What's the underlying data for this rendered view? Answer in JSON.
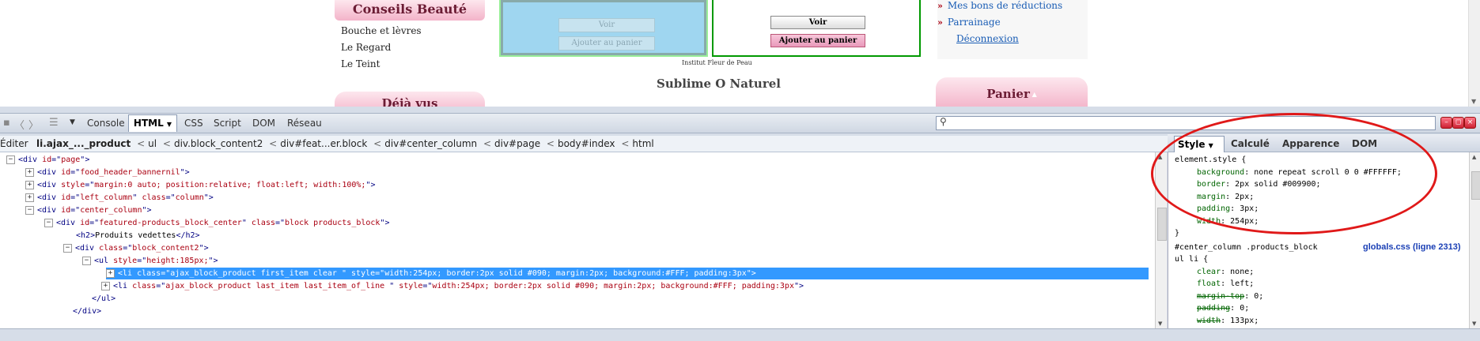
{
  "webpage": {
    "conseils_title": "Conseils Beauté",
    "conseils_items": [
      "Bouche et lèvres",
      "Le Regard",
      "Le Teint"
    ],
    "deja_vus_title": "Déjà vus",
    "product_left": {
      "voir_label": "Voir",
      "cart_label": "Ajouter au panier"
    },
    "product_right": {
      "voir_label": "Voir",
      "cart_label": "Ajouter au panier"
    },
    "institut_label": "Institut Fleur de Peau",
    "sublime_title": "Sublime O Naturel",
    "account_links": [
      "Mes bons de réductions",
      "Parrainage"
    ],
    "logout_link": "Déconnexion",
    "panier_title": "Panier"
  },
  "toolbar": {
    "console_tab": "Console",
    "html_tab": "HTML",
    "css_tab": "CSS",
    "script_tab": "Script",
    "dom_tab": "DOM",
    "reseau_tab": "Réseau",
    "search_placeholder": ""
  },
  "breadcrumb": {
    "edit_label": "Éditer",
    "current": "li.ajax_..._product",
    "items": [
      "ul",
      "div.block_content2",
      "div#feat...er.block",
      "div#center_column",
      "div#page",
      "body#index",
      "html"
    ]
  },
  "html_tree": [
    {
      "tw": "−",
      "tag": "div",
      "attrs": [
        [
          "id",
          "page"
        ]
      ]
    },
    {
      "tw": "+",
      "tag": "div",
      "attrs": [
        [
          "id",
          "food_header_bannernil"
        ]
      ]
    },
    {
      "tw": "+",
      "tag": "div",
      "attrs": [
        [
          "style",
          "margin:0 auto; position:relative; float:left; width:100%;"
        ]
      ]
    },
    {
      "tw": "+",
      "tag": "div",
      "attrs": [
        [
          "id",
          "left_column"
        ],
        [
          "class",
          "column"
        ]
      ]
    },
    {
      "tw": "−",
      "tag": "div",
      "attrs": [
        [
          "id",
          "center_column"
        ]
      ]
    },
    {
      "tw": "−",
      "tag": "div",
      "attrs": [
        [
          "id",
          "featured-products_block_center"
        ],
        [
          "class",
          "block products_block"
        ]
      ]
    },
    {
      "tw": "",
      "tag": "h2",
      "text": "Produits vedettes"
    },
    {
      "tw": "−",
      "tag": "div",
      "attrs": [
        [
          "class",
          "block_content2"
        ]
      ]
    },
    {
      "tw": "−",
      "tag": "ul",
      "attrs": [
        [
          "style",
          "height:185px;"
        ]
      ]
    },
    {
      "tw": "+",
      "tag": "li",
      "attrs": [
        [
          "class",
          "ajax_block_product first_item clear "
        ],
        [
          "style",
          "width:254px; border:2px solid #090; margin:2px; background:#FFF; padding:3px"
        ]
      ],
      "selected": true
    },
    {
      "tw": "+",
      "tag": "li",
      "attrs": [
        [
          "class",
          "ajax_block_product last_item last_item_of_line "
        ],
        [
          "style",
          "width:254px; border:2px solid #090; margin:2px; background:#FFF; padding:3px"
        ]
      ]
    },
    {
      "tw": "",
      "close": "ul"
    },
    {
      "tw": "",
      "close": "div"
    }
  ],
  "side_panel": {
    "tabs": [
      "Style",
      "Calculé",
      "Apparence",
      "DOM"
    ],
    "element_style_selector": "element.style {",
    "element_style_props": [
      {
        "name": "background",
        "value": "none repeat scroll 0 0 #FFFFFF;"
      },
      {
        "name": "border",
        "value": "2px solid #009900;"
      },
      {
        "name": "margin",
        "value": "2px;"
      },
      {
        "name": "padding",
        "value": "3px;"
      },
      {
        "name": "width",
        "value": "254px;"
      }
    ],
    "rule2_selector_line1": "#center_column .products_block",
    "rule2_selector_line2": "ul li {",
    "rule2_source": "globals.css (ligne 2313)",
    "rule2_props": [
      {
        "name": "clear",
        "value": "none;",
        "struck": false
      },
      {
        "name": "float",
        "value": "left;",
        "struck": false
      },
      {
        "name": "margin-top",
        "value": "0;",
        "struck": true
      },
      {
        "name": "padding",
        "value": "0;",
        "struck": true
      },
      {
        "name": "width",
        "value": "133px;",
        "struck": true
      }
    ]
  },
  "colors": {
    "selection": "#3399ff",
    "annotation": "#e01919",
    "tag": "#000082",
    "attr": "#aa0011"
  }
}
